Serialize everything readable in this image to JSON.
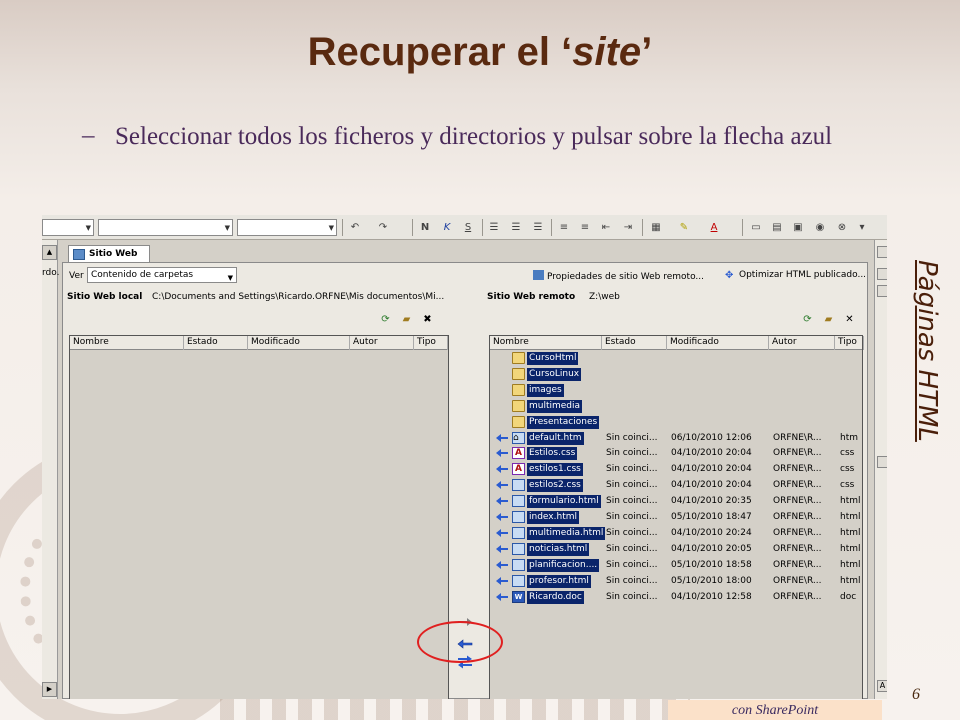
{
  "slide": {
    "title_plain": "Recuperar el ‘",
    "title_italic": "site",
    "title_end": "’",
    "bullet_dash": "–",
    "bullet": "Seleccionar todos los ficheros y directorios y pulsar sobre la flecha azul",
    "side_label": "Páginas HTML",
    "page_number": "6",
    "footer": "con SharePoint"
  },
  "app": {
    "left_strip_text": "rdo.",
    "doc_tab": "Sitio Web",
    "view_label": "Ver",
    "view_value": "Contenido de carpetas",
    "remote_props": "Propiedades de sitio Web remoto...",
    "optimize": "Optimizar HTML publicado...",
    "local_label": "Sitio Web local",
    "local_path": "C:\\Documents and Settings\\Ricardo.ORFNE\\Mis documentos\\Mi...",
    "remote_label": "Sitio Web remoto",
    "remote_path": "Z:\\web",
    "columns": [
      "Nombre",
      "Estado",
      "Modificado",
      "Autor",
      "Tipo"
    ],
    "toolbar_icons": [
      "undo-icon",
      "redo-icon",
      "bold-icon",
      "italic-icon",
      "underline-icon",
      "align-left-icon",
      "align-center-icon",
      "align-right-icon",
      "numbered-list-icon",
      "bullet-list-icon",
      "outdent-icon",
      "indent-icon",
      "border-icon",
      "highlight-icon",
      "font-color-icon"
    ],
    "remote_rows": [
      {
        "name": "CursoHtml",
        "type": "folder",
        "status": "",
        "modified": "",
        "author": "",
        "ext": "",
        "arrow": false
      },
      {
        "name": "CursoLinux",
        "type": "folder",
        "status": "",
        "modified": "",
        "author": "",
        "ext": "",
        "arrow": false
      },
      {
        "name": "images",
        "type": "folder",
        "status": "",
        "modified": "",
        "author": "",
        "ext": "",
        "arrow": false
      },
      {
        "name": "multimedia",
        "type": "folder",
        "status": "",
        "modified": "",
        "author": "",
        "ext": "",
        "arrow": false
      },
      {
        "name": "Presentaciones",
        "type": "folder",
        "status": "",
        "modified": "",
        "author": "",
        "ext": "",
        "arrow": false
      },
      {
        "name": "default.htm",
        "type": "home",
        "status": "Sin coinci...",
        "modified": "06/10/2010 12:06",
        "author": "ORFNE\\R...",
        "ext": "htm",
        "arrow": true
      },
      {
        "name": "Estilos.css",
        "type": "css",
        "status": "Sin coinci...",
        "modified": "04/10/2010 20:04",
        "author": "ORFNE\\R...",
        "ext": "css",
        "arrow": true
      },
      {
        "name": "estilos1.css",
        "type": "css",
        "status": "Sin coinci...",
        "modified": "04/10/2010 20:04",
        "author": "ORFNE\\R...",
        "ext": "css",
        "arrow": true
      },
      {
        "name": "estilos2.css",
        "type": "html",
        "status": "Sin coinci...",
        "modified": "04/10/2010 20:04",
        "author": "ORFNE\\R...",
        "ext": "css",
        "arrow": true
      },
      {
        "name": "formulario.html",
        "type": "html",
        "status": "Sin coinci...",
        "modified": "04/10/2010 20:35",
        "author": "ORFNE\\R...",
        "ext": "html",
        "arrow": true
      },
      {
        "name": "index.html",
        "type": "html",
        "status": "Sin coinci...",
        "modified": "05/10/2010 18:47",
        "author": "ORFNE\\R...",
        "ext": "html",
        "arrow": true
      },
      {
        "name": "multimedia.html",
        "type": "html",
        "status": "Sin coinci...",
        "modified": "04/10/2010 20:24",
        "author": "ORFNE\\R...",
        "ext": "html",
        "arrow": true
      },
      {
        "name": "noticias.html",
        "type": "html",
        "status": "Sin coinci...",
        "modified": "04/10/2010 20:05",
        "author": "ORFNE\\R...",
        "ext": "html",
        "arrow": true
      },
      {
        "name": "planificacion....",
        "type": "html",
        "status": "Sin coinci...",
        "modified": "05/10/2010 18:58",
        "author": "ORFNE\\R...",
        "ext": "html",
        "arrow": true
      },
      {
        "name": "profesor.html",
        "type": "html",
        "status": "Sin coinci...",
        "modified": "05/10/2010 18:00",
        "author": "ORFNE\\R...",
        "ext": "html",
        "arrow": true
      },
      {
        "name": "Ricardo.doc",
        "type": "doc",
        "status": "Sin coinci...",
        "modified": "04/10/2010 12:58",
        "author": "ORFNE\\R...",
        "ext": "doc",
        "arrow": true
      }
    ],
    "colors": {
      "selection": "#0a246a",
      "arrow_blue": "#2a5bd0",
      "highlight_circle": "#e02020"
    }
  }
}
